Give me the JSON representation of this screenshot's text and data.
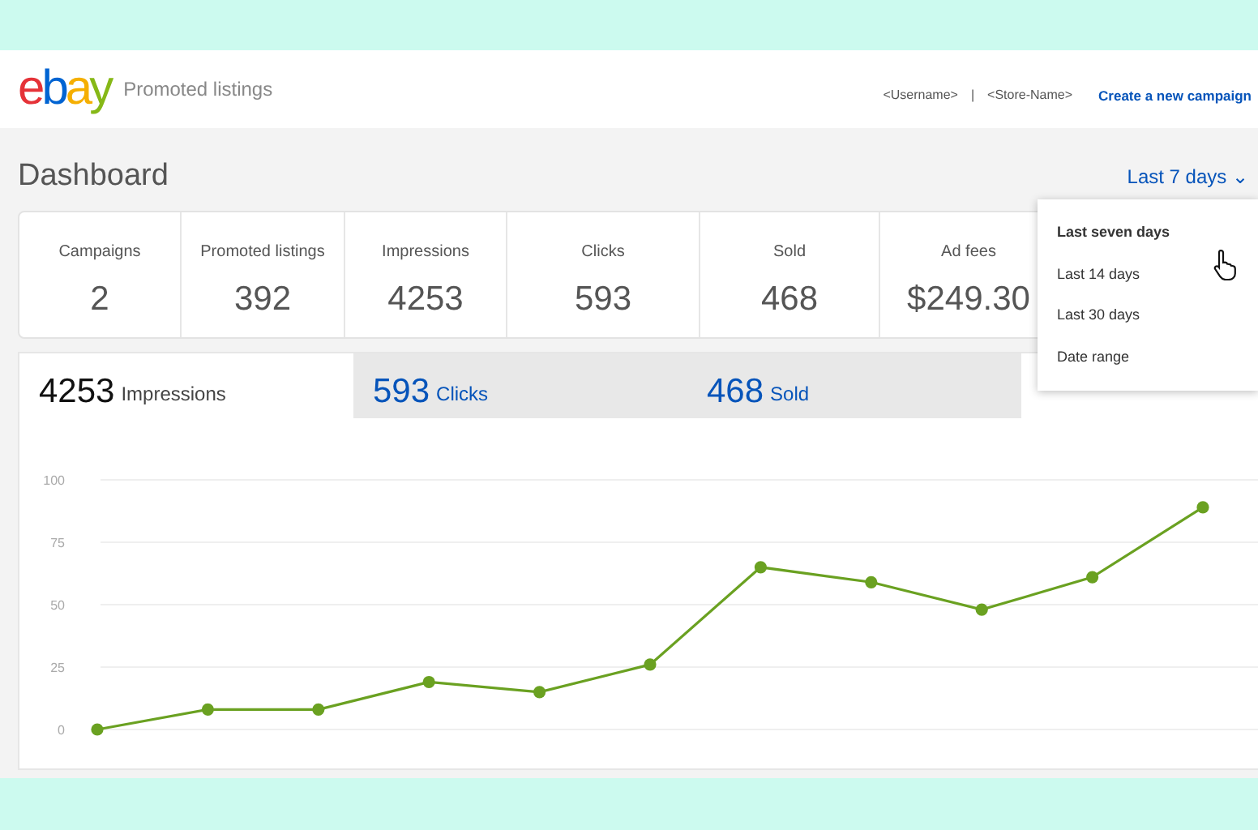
{
  "header": {
    "logo": "ebay",
    "product": "Promoted listings",
    "username": "<Username>",
    "separator": "|",
    "store": "<Store-Name>",
    "create_link": "Create a new campaign"
  },
  "page_title": "Dashboard",
  "range_button": {
    "label": "Last 7 days",
    "caret": "⌄"
  },
  "range_menu": [
    {
      "label": "Last seven days",
      "selected": true
    },
    {
      "label": "Last 14 days",
      "selected": false
    },
    {
      "label": "Last 30 days",
      "selected": false
    },
    {
      "label": "Date range",
      "selected": false
    }
  ],
  "stats": [
    {
      "label": "Campaigns",
      "value": "2"
    },
    {
      "label": "Promoted listings",
      "value": "392"
    },
    {
      "label": "Impressions",
      "value": "4253"
    },
    {
      "label": "Clicks",
      "value": "593"
    },
    {
      "label": "Sold",
      "value": "468"
    },
    {
      "label": "Ad fees",
      "value": "$249.30"
    }
  ],
  "tabs": [
    {
      "value": "4253",
      "label": "Impressions",
      "selected": true
    },
    {
      "value": "593",
      "label": "Clicks",
      "selected": false
    },
    {
      "value": "468",
      "label": "Sold",
      "selected": false
    }
  ],
  "chart_data": {
    "type": "line",
    "ylim": [
      0,
      100
    ],
    "yticks": [
      0,
      25,
      50,
      75,
      100
    ],
    "grid": true,
    "series": [
      {
        "color": "#6aa121",
        "marker": true,
        "values": [
          0,
          8,
          8,
          19,
          15,
          26,
          65,
          59,
          48,
          61,
          89
        ]
      }
    ]
  }
}
